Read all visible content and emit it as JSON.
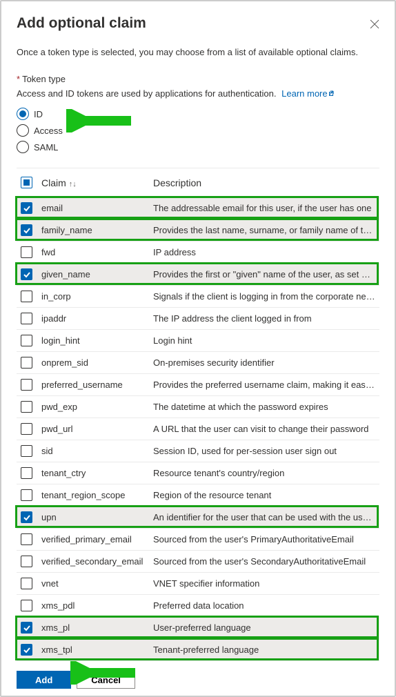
{
  "header": {
    "title": "Add optional claim",
    "description": "Once a token type is selected, you may choose from a list of available optional claims."
  },
  "token_type": {
    "label": "Token type",
    "hint": "Access and ID tokens are used by applications for authentication.",
    "learn_more": "Learn more",
    "options": {
      "id": "ID",
      "access": "Access",
      "saml": "SAML"
    },
    "selected": "id"
  },
  "table": {
    "headers": {
      "claim": "Claim",
      "description": "Description"
    },
    "rows": [
      {
        "claim": "email",
        "desc": "The addressable email for this user, if the user has one",
        "checked": true,
        "highlight": true
      },
      {
        "claim": "family_name",
        "desc": "Provides the last name, surname, or family name of the ...",
        "checked": true,
        "highlight": true
      },
      {
        "claim": "fwd",
        "desc": "IP address",
        "checked": false,
        "highlight": false
      },
      {
        "claim": "given_name",
        "desc": "Provides the first or \"given\" name of the user, as set on ...",
        "checked": true,
        "highlight": true
      },
      {
        "claim": "in_corp",
        "desc": "Signals if the client is logging in from the corporate net...",
        "checked": false,
        "highlight": false
      },
      {
        "claim": "ipaddr",
        "desc": "The IP address the client logged in from",
        "checked": false,
        "highlight": false
      },
      {
        "claim": "login_hint",
        "desc": "Login hint",
        "checked": false,
        "highlight": false
      },
      {
        "claim": "onprem_sid",
        "desc": "On-premises security identifier",
        "checked": false,
        "highlight": false
      },
      {
        "claim": "preferred_username",
        "desc": "Provides the preferred username claim, making it easier...",
        "checked": false,
        "highlight": false
      },
      {
        "claim": "pwd_exp",
        "desc": "The datetime at which the password expires",
        "checked": false,
        "highlight": false
      },
      {
        "claim": "pwd_url",
        "desc": "A URL that the user can visit to change their password",
        "checked": false,
        "highlight": false
      },
      {
        "claim": "sid",
        "desc": "Session ID, used for per-session user sign out",
        "checked": false,
        "highlight": false
      },
      {
        "claim": "tenant_ctry",
        "desc": "Resource tenant's country/region",
        "checked": false,
        "highlight": false
      },
      {
        "claim": "tenant_region_scope",
        "desc": "Region of the resource tenant",
        "checked": false,
        "highlight": false
      },
      {
        "claim": "upn",
        "desc": "An identifier for the user that can be used with the user...",
        "checked": true,
        "highlight": true
      },
      {
        "claim": "verified_primary_email",
        "desc": "Sourced from the user's PrimaryAuthoritativeEmail",
        "checked": false,
        "highlight": false
      },
      {
        "claim": "verified_secondary_email",
        "desc": "Sourced from the user's SecondaryAuthoritativeEmail",
        "checked": false,
        "highlight": false
      },
      {
        "claim": "vnet",
        "desc": "VNET specifier information",
        "checked": false,
        "highlight": false
      },
      {
        "claim": "xms_pdl",
        "desc": "Preferred data location",
        "checked": false,
        "highlight": false
      },
      {
        "claim": "xms_pl",
        "desc": "User-preferred language",
        "checked": true,
        "highlight": true
      },
      {
        "claim": "xms_tpl",
        "desc": "Tenant-preferred language",
        "checked": true,
        "highlight": true
      }
    ]
  },
  "footer": {
    "add": "Add",
    "cancel": "Cancel"
  }
}
